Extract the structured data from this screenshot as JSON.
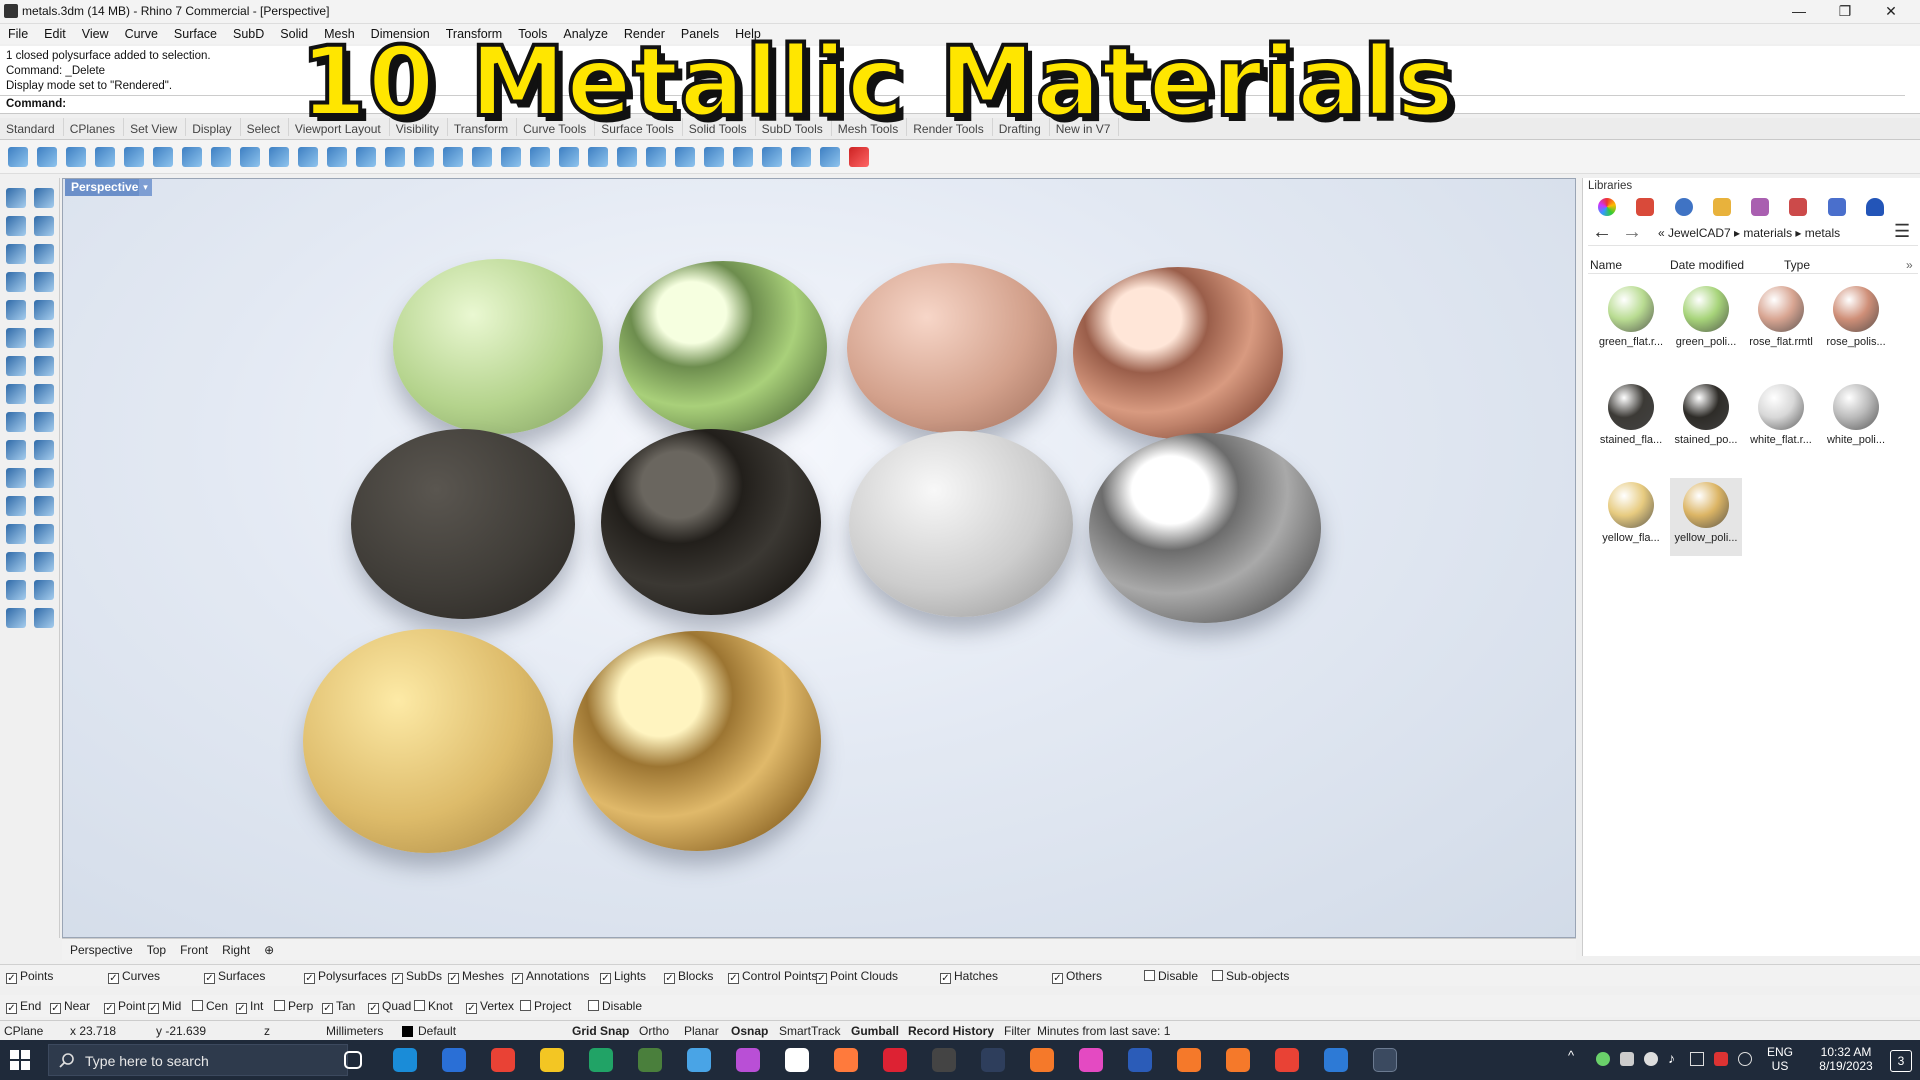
{
  "window": {
    "title": "metals.3dm (14 MB) - Rhino 7 Commercial - [Perspective]",
    "minimize": "—",
    "maximize": "❐",
    "close": "✕"
  },
  "overlay_title": "10 Metallic Materials",
  "menu": [
    "File",
    "Edit",
    "View",
    "Curve",
    "Surface",
    "SubD",
    "Solid",
    "Mesh",
    "Dimension",
    "Transform",
    "Tools",
    "Analyze",
    "Render",
    "Panels",
    "Help"
  ],
  "command_history": [
    "1 closed polysurface added to selection.",
    "Command: _Delete",
    "Display mode set to \"Rendered\"."
  ],
  "command_prompt": "Command:",
  "toolbar_tabs": [
    "Standard",
    "CPlanes",
    "Set View",
    "Display",
    "Select",
    "Viewport Layout",
    "Visibility",
    "Transform",
    "Curve Tools",
    "Surface Tools",
    "Solid Tools",
    "SubD Tools",
    "Mesh Tools",
    "Render Tools",
    "Drafting",
    "New in V7"
  ],
  "viewport": {
    "label": "Perspective",
    "dropdown": "▾"
  },
  "viewport_tabs": [
    "Perspective",
    "Top",
    "Front",
    "Right",
    "⊕"
  ],
  "spheres": [
    {
      "name": "green-flat",
      "finish": "flat",
      "c1": "#eaf8d2",
      "c2": "#b4d38c",
      "c3": "#7e9c5e"
    },
    {
      "name": "green-polished",
      "finish": "polished",
      "c1": "#f6ffe0",
      "c2": "#a9d07a",
      "c3": "#6d8d4e"
    },
    {
      "name": "rose-flat",
      "finish": "flat",
      "c1": "#f7d6c8",
      "c2": "#d3a18c",
      "c3": "#9c6b58"
    },
    {
      "name": "rose-polished",
      "finish": "polished",
      "c1": "#ffe6d8",
      "c2": "#d89a80",
      "c3": "#9a5e4a"
    },
    {
      "name": "stained-flat",
      "finish": "flat",
      "c1": "#5a5650",
      "c2": "#403d38",
      "c3": "#26231f"
    },
    {
      "name": "stained-polished",
      "finish": "polished",
      "c1": "#6a665f",
      "c2": "#3b3833",
      "c3": "#221f1b"
    },
    {
      "name": "white-flat",
      "finish": "flat",
      "c1": "#f8f8f8",
      "c2": "#cdcdcd",
      "c3": "#8f8f8f"
    },
    {
      "name": "white-polished",
      "finish": "polished",
      "c1": "#ffffff",
      "c2": "#a9a9a9",
      "c3": "#6c6c6c"
    },
    {
      "name": "yellow-flat",
      "finish": "flat",
      "c1": "#fdeaa6",
      "c2": "#ddbb6a",
      "c3": "#a4823e"
    },
    {
      "name": "yellow-polished",
      "finish": "polished",
      "c1": "#fff4c0",
      "c2": "#e0b96a",
      "c3": "#9c7532"
    }
  ],
  "libraries": {
    "header": "Libraries",
    "breadcrumb": "« JewelCAD7 ▸ materials ▸ metals",
    "columns": [
      "Name",
      "Date modified",
      "Type"
    ],
    "more": "»",
    "items": [
      {
        "label": "green_flat.r...",
        "color": "#b9dc92"
      },
      {
        "label": "green_poli...",
        "color": "#a7d47a"
      },
      {
        "label": "rose_flat.rmtl",
        "color": "#d8a592"
      },
      {
        "label": "rose_polis...",
        "color": "#cf8f78"
      },
      {
        "label": "stained_fla...",
        "color": "#3c3a36"
      },
      {
        "label": "stained_po...",
        "color": "#2e2c28"
      },
      {
        "label": "white_flat.r...",
        "color": "#d8d8d8"
      },
      {
        "label": "white_poli...",
        "color": "#bcbcbc"
      },
      {
        "label": "yellow_fla...",
        "color": "#e7cb80"
      },
      {
        "label": "yellow_poli...",
        "color": "#dcb565"
      }
    ]
  },
  "visibility_filters": [
    {
      "label": "Points",
      "checked": true
    },
    {
      "label": "Curves",
      "checked": true
    },
    {
      "label": "Surfaces",
      "checked": true
    },
    {
      "label": "Polysurfaces",
      "checked": true
    },
    {
      "label": "SubDs",
      "checked": true
    },
    {
      "label": "Meshes",
      "checked": true
    },
    {
      "label": "Annotations",
      "checked": true
    },
    {
      "label": "Lights",
      "checked": true
    },
    {
      "label": "Blocks",
      "checked": true
    },
    {
      "label": "Control Points",
      "checked": true
    },
    {
      "label": "Point Clouds",
      "checked": true
    },
    {
      "label": "Hatches",
      "checked": true
    },
    {
      "label": "Others",
      "checked": true
    },
    {
      "label": "Disable",
      "checked": false
    },
    {
      "label": "Sub-objects",
      "checked": false
    }
  ],
  "osnaps": [
    {
      "label": "End",
      "checked": true
    },
    {
      "label": "Near",
      "checked": true
    },
    {
      "label": "Point",
      "checked": true
    },
    {
      "label": "Mid",
      "checked": true
    },
    {
      "label": "Cen",
      "checked": false
    },
    {
      "label": "Int",
      "checked": true
    },
    {
      "label": "Perp",
      "checked": false
    },
    {
      "label": "Tan",
      "checked": true
    },
    {
      "label": "Quad",
      "checked": true
    },
    {
      "label": "Knot",
      "checked": false
    },
    {
      "label": "Vertex",
      "checked": true
    },
    {
      "label": "Project",
      "checked": false
    },
    {
      "label": "Disable",
      "checked": false
    }
  ],
  "status": {
    "cplane": "CPlane",
    "x": "x 23.718",
    "y": "y -21.639",
    "z": "z",
    "units": "Millimeters",
    "layer": "Default",
    "grid_snap": "Grid Snap",
    "ortho": "Ortho",
    "planar": "Planar",
    "osnap": "Osnap",
    "smarttrack": "SmartTrack",
    "gumball": "Gumball",
    "record_history": "Record History",
    "filter": "Filter",
    "save_info": "Minutes from last save: 1"
  },
  "taskbar": {
    "search_placeholder": "Type here to search",
    "lang": "ENG",
    "region": "US",
    "time": "10:32 AM",
    "date": "8/19/2023",
    "notifications": "3"
  }
}
